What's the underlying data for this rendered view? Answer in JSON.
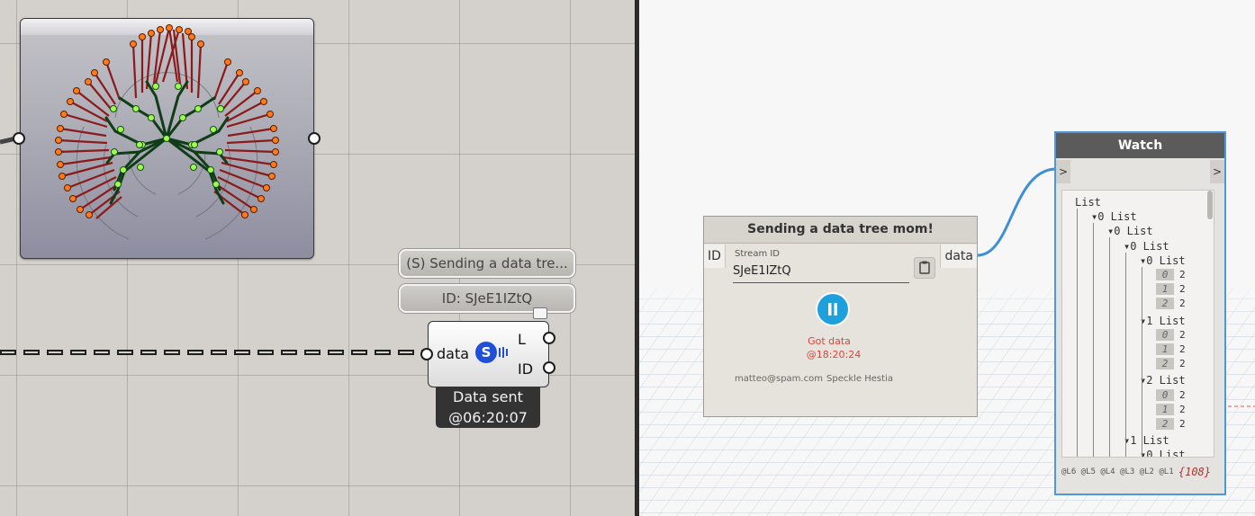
{
  "grasshopper": {
    "bubbles": {
      "name_label": "(S) Sending a data tre...",
      "id_label": "ID: SJeE1IZtQ"
    },
    "component": {
      "input_label": "data",
      "output_l": "L",
      "output_id": "ID",
      "icon_letter": "S",
      "status_line1": "Data sent",
      "status_line2": "@06:20:07"
    }
  },
  "dynamo": {
    "sender_node": {
      "title": "Sending a data tree mom!",
      "input_port": "ID",
      "output_port": "data",
      "stream_label": "Stream ID",
      "stream_value": "SJeE1IZtQ",
      "status_line1": "Got data",
      "status_line2": "@18:20:24",
      "user": "matteo@spam.com",
      "server": "Speckle Hestia"
    },
    "watch_node": {
      "title": "Watch",
      "in_port": ">",
      "out_port": ">",
      "tree": [
        {
          "indent": 0,
          "idx": "",
          "text": "List"
        },
        {
          "indent": 1,
          "idx": "0",
          "text": "List"
        },
        {
          "indent": 2,
          "idx": "0",
          "text": "List"
        },
        {
          "indent": 3,
          "idx": "0",
          "text": "List"
        },
        {
          "indent": 4,
          "idx": "0",
          "text": "List"
        }
      ],
      "groups": [
        {
          "label": "1 List",
          "values": [
            [
              "0",
              "2"
            ],
            [
              "1",
              "2"
            ],
            [
              "2",
              "2"
            ]
          ]
        },
        {
          "label": "2 List",
          "values": [
            [
              "0",
              "2"
            ],
            [
              "1",
              "2"
            ],
            [
              "2",
              "2"
            ]
          ]
        }
      ],
      "first_values": [
        [
          "0",
          "2"
        ],
        [
          "1",
          "2"
        ],
        [
          "2",
          "2"
        ]
      ],
      "tail": [
        {
          "indent": 3,
          "text": "1 List"
        },
        {
          "indent": 4,
          "text": "0 List"
        }
      ],
      "levels": [
        "@L6",
        "@L5",
        "@L4",
        "@L3",
        "@L2",
        "@L1"
      ],
      "count": "{108}"
    }
  },
  "colors": {
    "dynamo_accent": "#4e97d8",
    "status_red": "#e0433a",
    "play_button": "#1ea0dc"
  }
}
